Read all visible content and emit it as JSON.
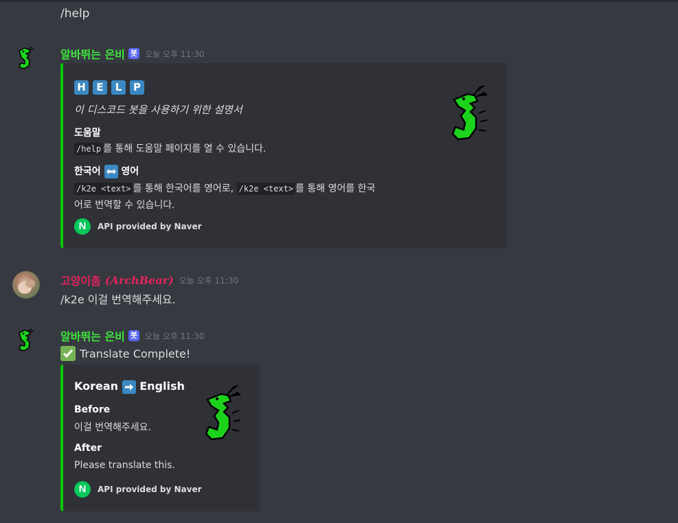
{
  "messages": [
    {
      "text": "/help"
    },
    {
      "author": "알바뛰는 은비",
      "badge": "봇",
      "time": "오늘 오후 11:30",
      "embed": {
        "title_letters": [
          "H",
          "E",
          "L",
          "P"
        ],
        "description": "이 디스코드 봇을 사용하기 위한 설명서",
        "fields": [
          {
            "name": "도움말",
            "code": "/help",
            "text": "를 통해 도움말 페이지를 열 수 있습니다."
          },
          {
            "name_left": "한국어",
            "name_icon": "left-right-arrow-icon",
            "name_right": "영어",
            "code1": "/k2e <text>",
            "text1": "를 통해 한국어를 영어로,",
            "code2": "/k2e <text>",
            "text2": "를 통해 영어를 한국",
            "text3": "어로 번역할 수 있습니다."
          }
        ],
        "footer": {
          "icon_letter": "N",
          "text": "API provided by Naver"
        }
      }
    },
    {
      "author": "고양이춤",
      "author_nick": "(ArchBear)",
      "time": "오늘 오후 11:30",
      "text": "/k2e 이걸 번역해주세요."
    },
    {
      "author": "알바뛰는 은비",
      "badge": "봇",
      "time": "오늘 오후 11:30",
      "text": "Translate Complete!",
      "embed": {
        "title_left": "Korean",
        "title_icon": "right-arrow-icon",
        "title_right": "English",
        "fields": [
          {
            "name": "Before",
            "value": "이걸 번역해주세요."
          },
          {
            "name": "After",
            "value": "Please translate this."
          }
        ],
        "footer": {
          "icon_letter": "N",
          "text": "API provided by Naver"
        }
      }
    }
  ],
  "colors": {
    "bot_name": "#3ee63e",
    "user_name": "#e0245e",
    "embed_border": "#09c709",
    "timestamp": "#72767d",
    "naver": "#03c75a",
    "tile_blue": "#3b88c3"
  }
}
